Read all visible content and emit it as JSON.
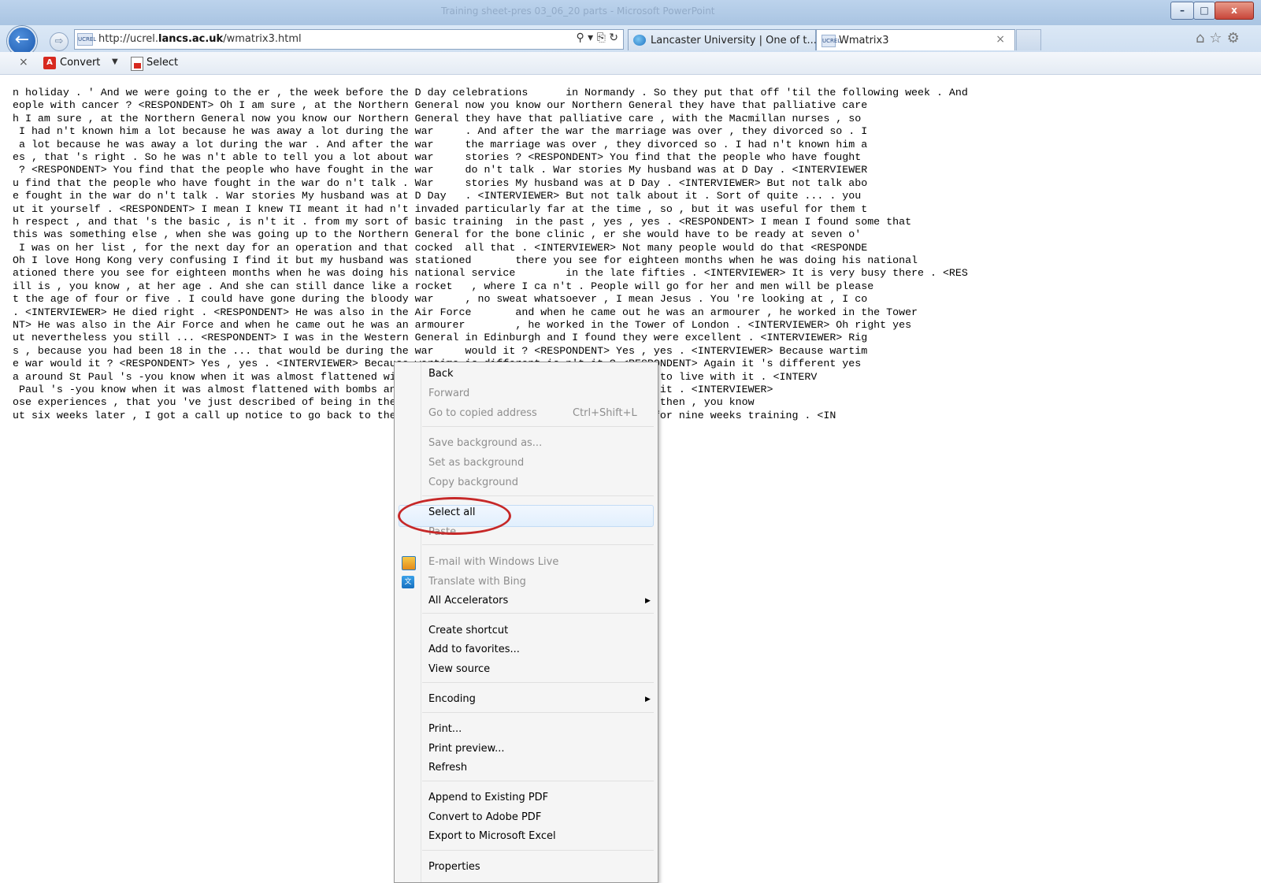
{
  "window": {
    "title": "Training sheet-pres 03_06_20 parts - Microsoft PowerPoint",
    "min_label": "–",
    "max_label": "□",
    "close_label": "x"
  },
  "nav": {
    "back_glyph": "←",
    "forward_glyph": "⇨",
    "url_prefix": "http://ucrel.",
    "url_domain": "lancs.ac.uk",
    "url_suffix": "/wmatrix3.html",
    "addr_controls": "⚲ ▾ ⎘ ↻",
    "tabs": [
      {
        "label": "Lancaster University | One of t...",
        "icon": "ie-globe-icon"
      },
      {
        "label": "Wmatrix3",
        "icon": "site-icon"
      }
    ],
    "tab_close": "×",
    "right_icons": "⌂☆⚙"
  },
  "toolbar": {
    "close": "×",
    "convert_label": "Convert",
    "convert_arrow": "▼",
    "select_label": "Select"
  },
  "content_lines": [
    "n holiday . ' And we were going to the er , the week before the D day celebrations      in Normandy . So they put that off 'til the following week . And",
    "eople with cancer ? <RESPONDENT> Oh I am sure , at the Northern General now you know our Northern General they have that palliative care",
    "h I am sure , at the Northern General now you know our Northern General they have that palliative care , with the Macmillan nurses , so",
    " I had n't known him a lot because he was away a lot during the war     . And after the war the marriage was over , they divorced so . I",
    " a lot because he was away a lot during the war . And after the war     the marriage was over , they divorced so . I had n't known him a",
    "es , that 's right . So he was n't able to tell you a lot about war     stories ? <RESPONDENT> You find that the people who have fought",
    " ? <RESPONDENT> You find that the people who have fought in the war     do n't talk . War stories My husband was at D Day . <INTERVIEWER",
    "u find that the people who have fought in the war do n't talk . War     stories My husband was at D Day . <INTERVIEWER> But not talk abo",
    "e fought in the war do n't talk . War stories My husband was at D Day   . <INTERVIEWER> But not talk about it . Sort of quite ... . you",
    "ut it yourself . <RESPONDENT> I mean I knew TI meant it had n't invaded particularly far at the time , so , but it was useful for them t",
    "h respect , and that 's the basic , is n't it . from my sort of basic training  in the past , yes , yes . <RESPONDENT> I mean I found some that",
    "this was something else , when she was going up to the Northern General for the bone clinic , er she would have to be ready at seven o'",
    " I was on her list , for the next day for an operation and that cocked  all that . <INTERVIEWER> Not many people would do that <RESPONDE",
    "Oh I love Hong Kong very confusing I find it but my husband was stationed       there you see for eighteen months when he was doing his national",
    "ationed there you see for eighteen months when he was doing his national service        in the late fifties . <INTERVIEWER> It is very busy there . <RES",
    "ill is , you know , at her age . And she can still dance like a rocket   , where I ca n't . People will go for her and men will be please",
    "t the age of four or five . I could have gone during the bloody war     , no sweat whatsoever , I mean Jesus . You 're looking at , I co",
    ". <INTERVIEWER> He died right . <RESPONDENT> He was also in the Air Force       and when he came out he was an armourer , he worked in the Tower",
    "NT> He was also in the Air Force and when he came out he was an armourer        , he worked in the Tower of London . <INTERVIEWER> Oh right yes",
    "ut nevertheless you still ... <RESPONDENT> I was in the Western General in Edinburgh and I found they were excellent . <INTERVIEWER> Rig",
    "s , because you had been 18 in the ... that would be during the war     would it ? <RESPONDENT> Yes , yes . <INTERVIEWER> Because wartim",
    "e war would it ? <RESPONDENT> Yes , yes . <INTERVIEWER> Because wartime is different is n't it ? <RESPONDENT> Again it 's different yes",
    "a around St Paul 's -you know when it was almost flattened with bombs and things . And you just learnt to live with it . <INTERV",
    " Paul 's -you know when it was almost flattened with bombs and things and you just learnt to live with it . <INTERVIEWER>",
    "ose experiences , that you 've just described of being in the war and things that you had to deal with then , you know",
    "ut six weeks later , I got a call up notice to go back to the Royal Engineers and the Royal Engineers for nine weeks training . <IN"
  ],
  "context_menu": {
    "items": [
      {
        "label": "Back",
        "enabled": true
      },
      {
        "label": "Forward",
        "enabled": false
      },
      {
        "label": "Go to copied address",
        "enabled": false,
        "shortcut": "Ctrl+Shift+L"
      },
      {
        "label": "Save background as...",
        "enabled": false
      },
      {
        "label": "Set as background",
        "enabled": false
      },
      {
        "label": "Copy background",
        "enabled": false
      },
      {
        "label": "Select all",
        "enabled": true,
        "highlighted": true
      },
      {
        "label": "Paste",
        "enabled": false
      },
      {
        "label": "E-mail with Windows Live",
        "enabled": false,
        "icon": "windows-live-icon"
      },
      {
        "label": "Translate with Bing",
        "enabled": false,
        "icon": "translate-icon"
      },
      {
        "label": "All Accelerators",
        "enabled": true,
        "submenu": true
      },
      {
        "label": "Create shortcut",
        "enabled": true
      },
      {
        "label": "Add to favorites...",
        "enabled": true
      },
      {
        "label": "View source",
        "enabled": true
      },
      {
        "label": "Encoding",
        "enabled": true,
        "submenu": true
      },
      {
        "label": "Print...",
        "enabled": true
      },
      {
        "label": "Print preview...",
        "enabled": true
      },
      {
        "label": "Refresh",
        "enabled": true
      },
      {
        "label": "Append to Existing PDF",
        "enabled": true
      },
      {
        "label": "Convert to Adobe PDF",
        "enabled": true
      },
      {
        "label": "Export to Microsoft Excel",
        "enabled": true
      },
      {
        "label": "Properties",
        "enabled": true
      }
    ],
    "submenu_arrow": "▶",
    "annotation_color": "#c62828"
  }
}
